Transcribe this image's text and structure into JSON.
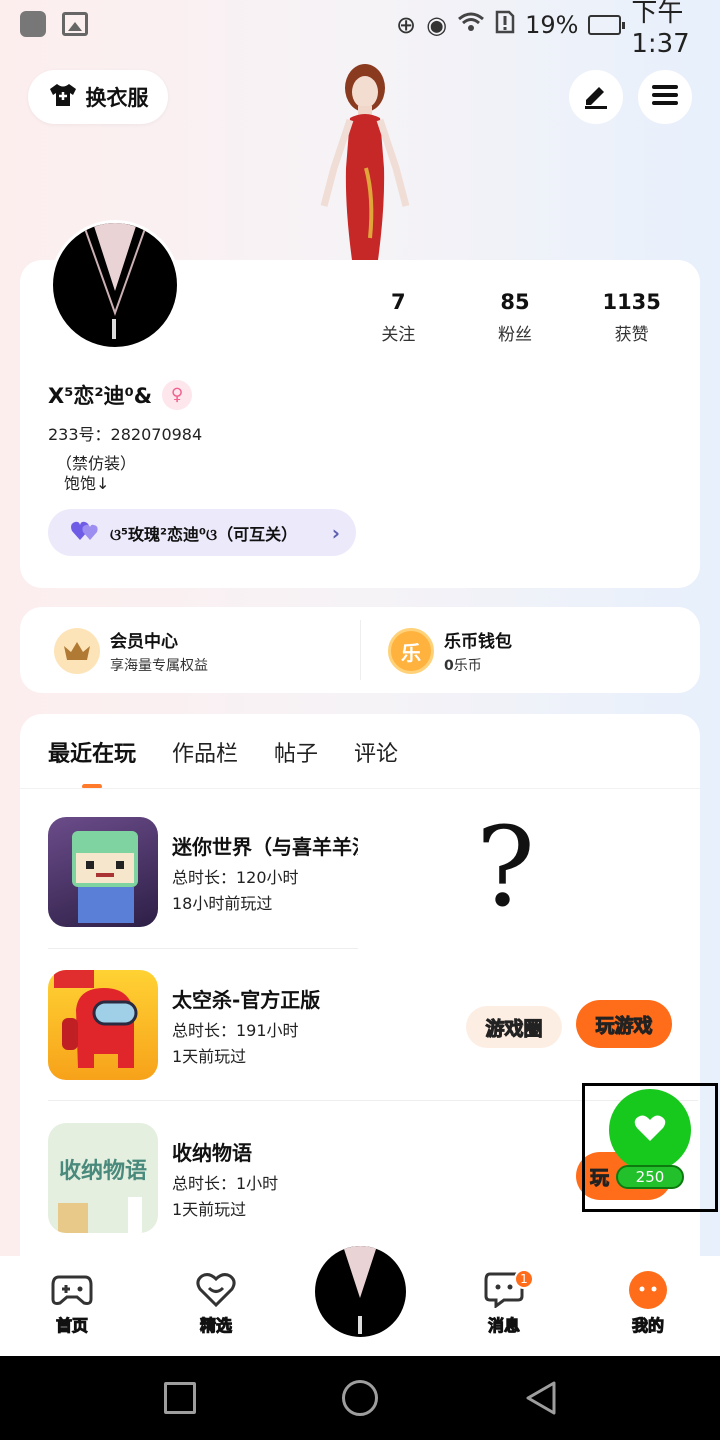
{
  "status_bar": {
    "battery": "19%",
    "time": "下午1:37"
  },
  "header": {
    "outfit_label": "换衣服"
  },
  "profile": {
    "stats": [
      {
        "value": "7",
        "label": "关注"
      },
      {
        "value": "85",
        "label": "粉丝"
      },
      {
        "value": "1135",
        "label": "获赞"
      }
    ],
    "username": "X⁵恋²迪⁰&",
    "gender_symbol": "♀",
    "user_id": "233号：282070984",
    "bio_line1": "（禁仿装）",
    "bio_line2": "饱饱↓",
    "group_name": "ଓ⁵玫瑰²恋迪⁰ଓ（可互关）"
  },
  "membership": {
    "vip_title": "会员中心",
    "vip_sub": "享海量专属权益",
    "wallet_title": "乐币钱包",
    "wallet_coin_glyph": "乐",
    "wallet_amount": "0",
    "wallet_unit": "乐币"
  },
  "tabs": [
    "最近在玩",
    "作品栏",
    "帖子",
    "评论"
  ],
  "games": [
    {
      "name": "迷你世界（与喜羊羊沙",
      "duration": "总时长：120小时",
      "last_played": "18小时前玩过",
      "icon": "mini-world-icon"
    },
    {
      "name": "太空杀-官方正版",
      "duration": "总时长：191小时",
      "last_played": "1天前玩过",
      "icon": "among-us-icon"
    },
    {
      "name": "收纳物语",
      "duration": "总时长：1小时",
      "last_played": "1天前玩过",
      "icon": "storage-story-icon",
      "icon_text": "收纳物语"
    }
  ],
  "overlay": {
    "qmark": "?",
    "circle_label": "游戏圈",
    "play_label": "玩游戏",
    "play_label_row3": "玩"
  },
  "like_widget": {
    "count": "250",
    "color": "#18c91d"
  },
  "bottom_nav": {
    "items": [
      "首页",
      "精选",
      "消息",
      "我的"
    ],
    "message_badge": "1"
  },
  "colors": {
    "accent": "#ff6d1a",
    "like": "#18c91d",
    "pill_bg": "#ece9fb"
  }
}
